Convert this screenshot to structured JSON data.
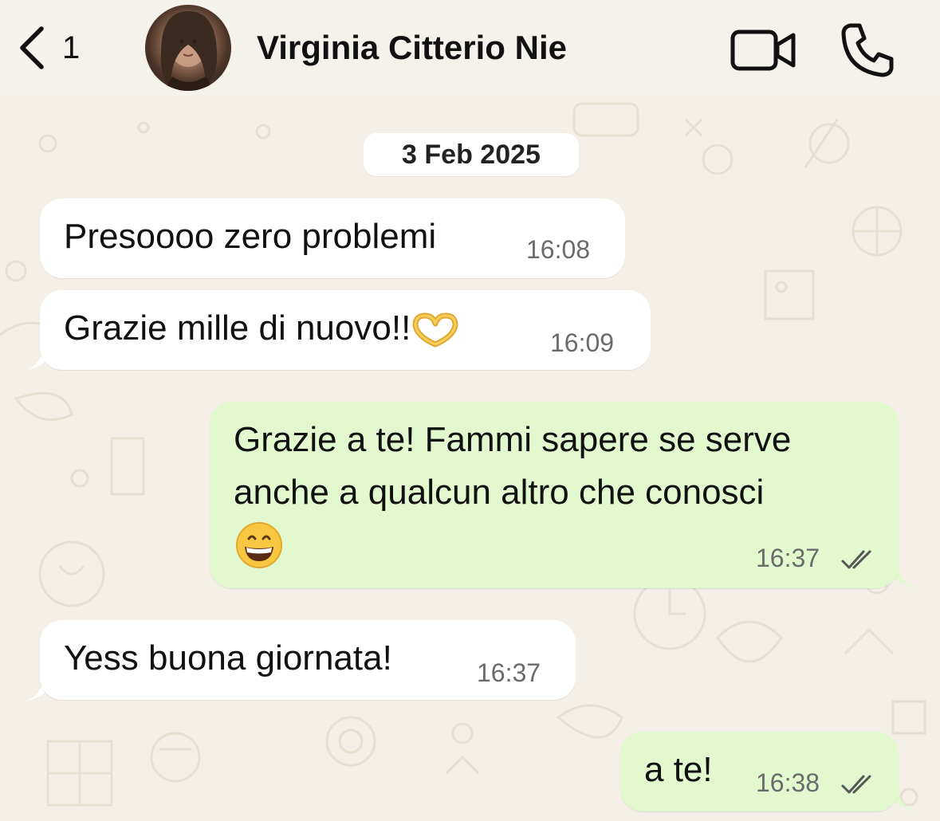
{
  "header": {
    "unread_count": "1",
    "contact_name": "Virginia Citterio Nie"
  },
  "date_divider": "3 Feb 2025",
  "messages": [
    {
      "direction": "incoming",
      "text": "Presoooo zero problemi",
      "time": "16:08"
    },
    {
      "direction": "incoming",
      "text": "Grazie mille di nuovo!!",
      "emoji": "heart-hands-emoji",
      "time": "16:09"
    },
    {
      "direction": "outgoing",
      "lines": [
        "Grazie a te! Fammi sapere se serve",
        "anche a qualcun altro che conosci"
      ],
      "emoji": "grinning-face-emoji",
      "time": "16:37",
      "status": "read"
    },
    {
      "direction": "incoming",
      "text": "Yess buona giornata!",
      "time": "16:37"
    },
    {
      "direction": "outgoing",
      "text": "a te!",
      "time": "16:38",
      "status": "read"
    }
  ],
  "icons": {
    "back": "chevron-left-icon",
    "video": "video-camera-icon",
    "call": "phone-icon",
    "read_receipt": "double-check-icon"
  },
  "colors": {
    "background": "#f4f0e8",
    "incoming_bubble": "#ffffff",
    "outgoing_bubble": "#e2f9cf",
    "read_ticks": "#555555"
  }
}
